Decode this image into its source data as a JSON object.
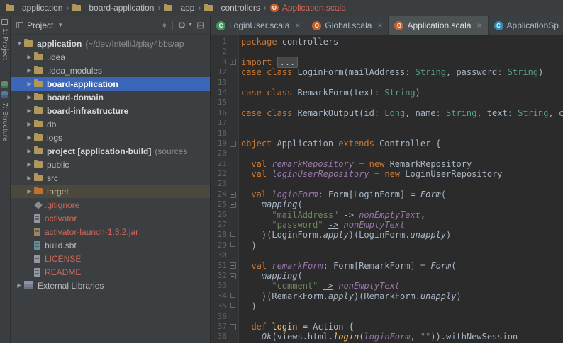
{
  "breadcrumbs": {
    "items": [
      {
        "label": "application",
        "icon": "folder"
      },
      {
        "label": "board-application",
        "icon": "folder"
      },
      {
        "label": "app",
        "icon": "folder"
      },
      {
        "label": "controllers",
        "icon": "folder"
      },
      {
        "label": "Application.scala",
        "icon": "scala-object",
        "icon_letter": "O",
        "icon_color": "#C4612C",
        "current": true
      }
    ]
  },
  "stripe": {
    "project_label": "1: Project",
    "structure_label": "7: Structure"
  },
  "project_panel": {
    "title": "Project",
    "header_icons": [
      {
        "name": "scroll-from-source-icon",
        "glyph": "⌖"
      },
      {
        "name": "divider",
        "glyph": ""
      },
      {
        "name": "settings-gear-icon",
        "glyph": "⚙"
      },
      {
        "name": "hide-panel-icon",
        "glyph": "⊟"
      }
    ],
    "tree": [
      {
        "level": 0,
        "arrow": "▼",
        "icon": "folder",
        "label": "application",
        "bold": true,
        "suffix": "(~/dev/IntelliJ/play4bbs/ap"
      },
      {
        "level": 1,
        "arrow": "▶",
        "icon": "folder",
        "label": ".idea"
      },
      {
        "level": 1,
        "arrow": "▶",
        "icon": "folder",
        "label": ".idea_modules"
      },
      {
        "level": 1,
        "arrow": "▶",
        "icon": "folder",
        "label": "board-application",
        "bold": true,
        "state": "selected"
      },
      {
        "level": 1,
        "arrow": "▶",
        "icon": "folder",
        "label": "board-domain",
        "bold": true
      },
      {
        "level": 1,
        "arrow": "▶",
        "icon": "folder",
        "label": "board-infrastructure",
        "bold": true
      },
      {
        "level": 1,
        "arrow": "▶",
        "icon": "folder",
        "label": "db"
      },
      {
        "level": 1,
        "arrow": "▶",
        "icon": "folder",
        "label": "logs"
      },
      {
        "level": 1,
        "arrow": "▶",
        "icon": "folder",
        "label": "project [application-build]",
        "bold": true,
        "suffix": "(sources"
      },
      {
        "level": 1,
        "arrow": "▶",
        "icon": "folder",
        "label": "public"
      },
      {
        "level": 1,
        "arrow": "▶",
        "icon": "folder",
        "label": "src"
      },
      {
        "level": 1,
        "arrow": "▶",
        "icon": "folder-excluded",
        "label": "target",
        "state": "excluded"
      },
      {
        "level": 1,
        "icon": "gitignore",
        "label": ".gitignore",
        "color": "vcs"
      },
      {
        "level": 1,
        "icon": "file",
        "label": "activator",
        "color": "vcs"
      },
      {
        "level": 1,
        "icon": "jar",
        "label": "activator-launch-1.3.2.jar",
        "color": "vcs"
      },
      {
        "level": 1,
        "icon": "sbt",
        "label": "build.sbt"
      },
      {
        "level": 1,
        "icon": "file",
        "label": "LICENSE",
        "color": "vcs"
      },
      {
        "level": 1,
        "icon": "file",
        "label": "README",
        "color": "vcs"
      },
      {
        "level": 0,
        "arrow": "▶",
        "icon": "libraries",
        "label": "External Libraries"
      }
    ]
  },
  "tabs": [
    {
      "label": "LoginUser.scala",
      "icon": {
        "name": "scala-case-class-icon",
        "letter": "C",
        "color": "#3C9A5F"
      },
      "close": "×"
    },
    {
      "label": "Global.scala",
      "icon": {
        "name": "scala-object-icon",
        "letter": "O",
        "color": "#C4612C"
      },
      "close": "×"
    },
    {
      "label": "Application.scala",
      "active": true,
      "icon": {
        "name": "scala-object-icon",
        "letter": "O",
        "color": "#C4612C"
      },
      "close": "×"
    },
    {
      "label": "ApplicationSp",
      "icon": {
        "name": "scala-class-icon",
        "letter": "C",
        "color": "#2F8BB5"
      }
    }
  ],
  "editor": {
    "lines": [
      {
        "n": 1,
        "segs": [
          [
            "kw",
            "package"
          ],
          [
            "pl",
            " controllers"
          ]
        ]
      },
      {
        "n": 2,
        "segs": []
      },
      {
        "n": 3,
        "fold": "+",
        "segs": [
          [
            "kw",
            "import"
          ],
          [
            "pl",
            " "
          ],
          [
            "folded",
            "..."
          ]
        ]
      },
      {
        "n": 12,
        "segs": [
          [
            "kw",
            "case class"
          ],
          [
            "pl",
            " LoginForm(mailAddress: "
          ],
          [
            "type",
            "String"
          ],
          [
            "pl",
            ", password: "
          ],
          [
            "type",
            "String"
          ],
          [
            "pl",
            ")"
          ]
        ]
      },
      {
        "n": 13,
        "segs": []
      },
      {
        "n": 14,
        "segs": [
          [
            "kw",
            "case class"
          ],
          [
            "pl",
            " RemarkForm(text: "
          ],
          [
            "type",
            "String"
          ],
          [
            "pl",
            ")"
          ]
        ]
      },
      {
        "n": 15,
        "segs": []
      },
      {
        "n": 16,
        "segs": [
          [
            "kw",
            "case class"
          ],
          [
            "pl",
            " RemarkOutput(id: "
          ],
          [
            "type",
            "Long"
          ],
          [
            "pl",
            ", name: "
          ],
          [
            "type",
            "String"
          ],
          [
            "pl",
            ", text: "
          ],
          [
            "type",
            "String"
          ],
          [
            "pl",
            ", created"
          ]
        ]
      },
      {
        "n": 17,
        "segs": []
      },
      {
        "n": 18,
        "segs": []
      },
      {
        "n": 19,
        "fold": "-",
        "segs": [
          [
            "kw",
            "object"
          ],
          [
            "pl",
            " Application "
          ],
          [
            "kw",
            "extends"
          ],
          [
            "pl",
            " Controller {"
          ]
        ]
      },
      {
        "n": 20,
        "segs": []
      },
      {
        "n": 21,
        "segs": [
          [
            "pl",
            "  "
          ],
          [
            "kw",
            "val"
          ],
          [
            "pl",
            " "
          ],
          [
            "field",
            "remarkRepository"
          ],
          [
            "pl",
            " = "
          ],
          [
            "kw",
            "new"
          ],
          [
            "pl",
            " RemarkRepository"
          ]
        ]
      },
      {
        "n": 22,
        "segs": [
          [
            "pl",
            "  "
          ],
          [
            "kw",
            "val"
          ],
          [
            "pl",
            " "
          ],
          [
            "field",
            "loginUserRepository"
          ],
          [
            "pl",
            " = "
          ],
          [
            "kw",
            "new"
          ],
          [
            "pl",
            " LoginUserRepository"
          ]
        ]
      },
      {
        "n": 23,
        "segs": []
      },
      {
        "n": 24,
        "fold": "-",
        "segs": [
          [
            "pl",
            "  "
          ],
          [
            "kw",
            "val"
          ],
          [
            "pl",
            " "
          ],
          [
            "field",
            "loginForm"
          ],
          [
            "pl",
            ": Form[LoginForm] = "
          ],
          [
            "it",
            "Form"
          ],
          [
            "pl",
            "("
          ]
        ]
      },
      {
        "n": 25,
        "fold": "-",
        "segs": [
          [
            "pl",
            "    "
          ],
          [
            "it",
            "mapping"
          ],
          [
            "pl",
            "("
          ]
        ]
      },
      {
        "n": 26,
        "segs": [
          [
            "pl",
            "      "
          ],
          [
            "str",
            "\"mailAddress\""
          ],
          [
            "pl",
            " "
          ],
          [
            "op",
            "->"
          ],
          [
            "pl",
            " "
          ],
          [
            "field",
            "nonEmptyText"
          ],
          [
            "pl",
            ","
          ]
        ]
      },
      {
        "n": 27,
        "segs": [
          [
            "pl",
            "      "
          ],
          [
            "str",
            "\"password\""
          ],
          [
            "pl",
            " "
          ],
          [
            "op",
            "->"
          ],
          [
            "pl",
            " "
          ],
          [
            "field",
            "nonEmptyText"
          ]
        ]
      },
      {
        "n": 28,
        "fold": "end",
        "segs": [
          [
            "pl",
            "    )(LoginForm."
          ],
          [
            "it",
            "apply"
          ],
          [
            "pl",
            ")(LoginForm."
          ],
          [
            "it",
            "unapply"
          ],
          [
            "pl",
            ")"
          ]
        ]
      },
      {
        "n": 29,
        "fold": "end",
        "segs": [
          [
            "pl",
            "  )"
          ]
        ]
      },
      {
        "n": 30,
        "segs": []
      },
      {
        "n": 31,
        "fold": "-",
        "segs": [
          [
            "pl",
            "  "
          ],
          [
            "kw",
            "val"
          ],
          [
            "pl",
            " "
          ],
          [
            "field",
            "remarkForm"
          ],
          [
            "pl",
            ": Form[RemarkForm] = "
          ],
          [
            "it",
            "Form"
          ],
          [
            "pl",
            "("
          ]
        ]
      },
      {
        "n": 32,
        "fold": "-",
        "segs": [
          [
            "pl",
            "    "
          ],
          [
            "it",
            "mapping"
          ],
          [
            "pl",
            "("
          ]
        ]
      },
      {
        "n": 33,
        "segs": [
          [
            "pl",
            "      "
          ],
          [
            "str",
            "\"comment\""
          ],
          [
            "pl",
            " "
          ],
          [
            "op",
            "->"
          ],
          [
            "pl",
            " "
          ],
          [
            "field",
            "nonEmptyText"
          ]
        ]
      },
      {
        "n": 34,
        "fold": "end",
        "segs": [
          [
            "pl",
            "    )(RemarkForm."
          ],
          [
            "it",
            "apply"
          ],
          [
            "pl",
            ")(RemarkForm."
          ],
          [
            "it",
            "unapply"
          ],
          [
            "pl",
            ")"
          ]
        ]
      },
      {
        "n": 35,
        "fold": "end",
        "segs": [
          [
            "pl",
            "  )"
          ]
        ]
      },
      {
        "n": 36,
        "segs": []
      },
      {
        "n": 37,
        "fold": "-",
        "segs": [
          [
            "pl",
            "  "
          ],
          [
            "kw",
            "def"
          ],
          [
            "pl",
            " "
          ],
          [
            "fn",
            "login"
          ],
          [
            "pl",
            " = Action {"
          ]
        ]
      },
      {
        "n": 38,
        "segs": [
          [
            "pl",
            "    "
          ],
          [
            "it",
            "Ok"
          ],
          [
            "pl",
            "(views.html."
          ],
          [
            "itfn",
            "login"
          ],
          [
            "pl",
            "("
          ],
          [
            "field",
            "loginForm"
          ],
          [
            "pl",
            ", "
          ],
          [
            "str",
            "\"\""
          ],
          [
            "pl",
            ")).withNewSession"
          ]
        ]
      }
    ]
  },
  "colors": {
    "selection_blue": "#3C67B8",
    "vcs_unversioned_red": "#D1675A",
    "keyword_orange": "#CC7832",
    "string_green": "#6A8759",
    "field_purple": "#9876AA",
    "editor_bg": "#2B2B2B",
    "panel_bg": "#3C3F41"
  }
}
